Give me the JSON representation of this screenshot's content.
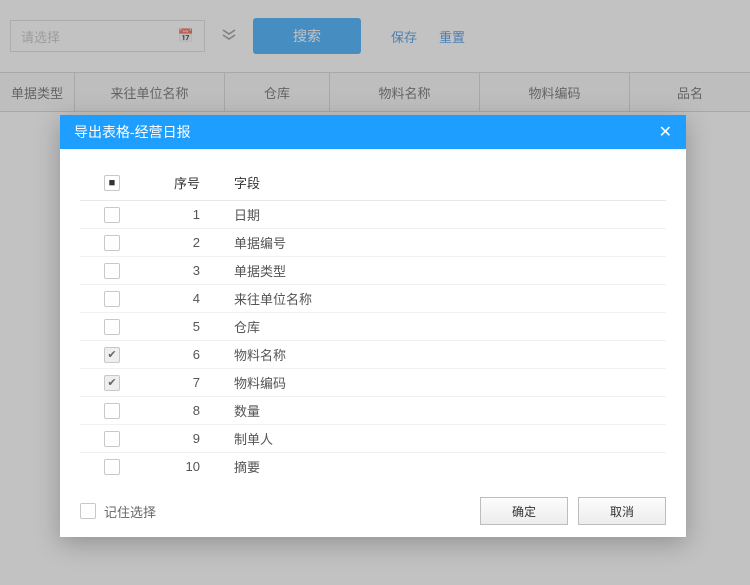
{
  "toolbar": {
    "date_placeholder": "请选择",
    "search_label": "搜索",
    "save_label": "保存",
    "reset_label": "重置"
  },
  "grid_columns": [
    "单据类型",
    "来往单位名称",
    "仓库",
    "物料名称",
    "物料编码",
    "品名"
  ],
  "modal": {
    "title": "导出表格-经营日报",
    "header_index": "序号",
    "header_field": "字段",
    "remember_label": "记住选择",
    "ok_label": "确定",
    "cancel_label": "取消",
    "rows": [
      {
        "idx": 1,
        "field": "日期",
        "checked": false
      },
      {
        "idx": 2,
        "field": "单据编号",
        "checked": false
      },
      {
        "idx": 3,
        "field": "单据类型",
        "checked": false
      },
      {
        "idx": 4,
        "field": "来往单位名称",
        "checked": false
      },
      {
        "idx": 5,
        "field": "仓库",
        "checked": false
      },
      {
        "idx": 6,
        "field": "物料名称",
        "checked": true
      },
      {
        "idx": 7,
        "field": "物料编码",
        "checked": true
      },
      {
        "idx": 8,
        "field": "数量",
        "checked": false
      },
      {
        "idx": 9,
        "field": "制单人",
        "checked": false
      },
      {
        "idx": 10,
        "field": "摘要",
        "checked": false
      }
    ]
  }
}
